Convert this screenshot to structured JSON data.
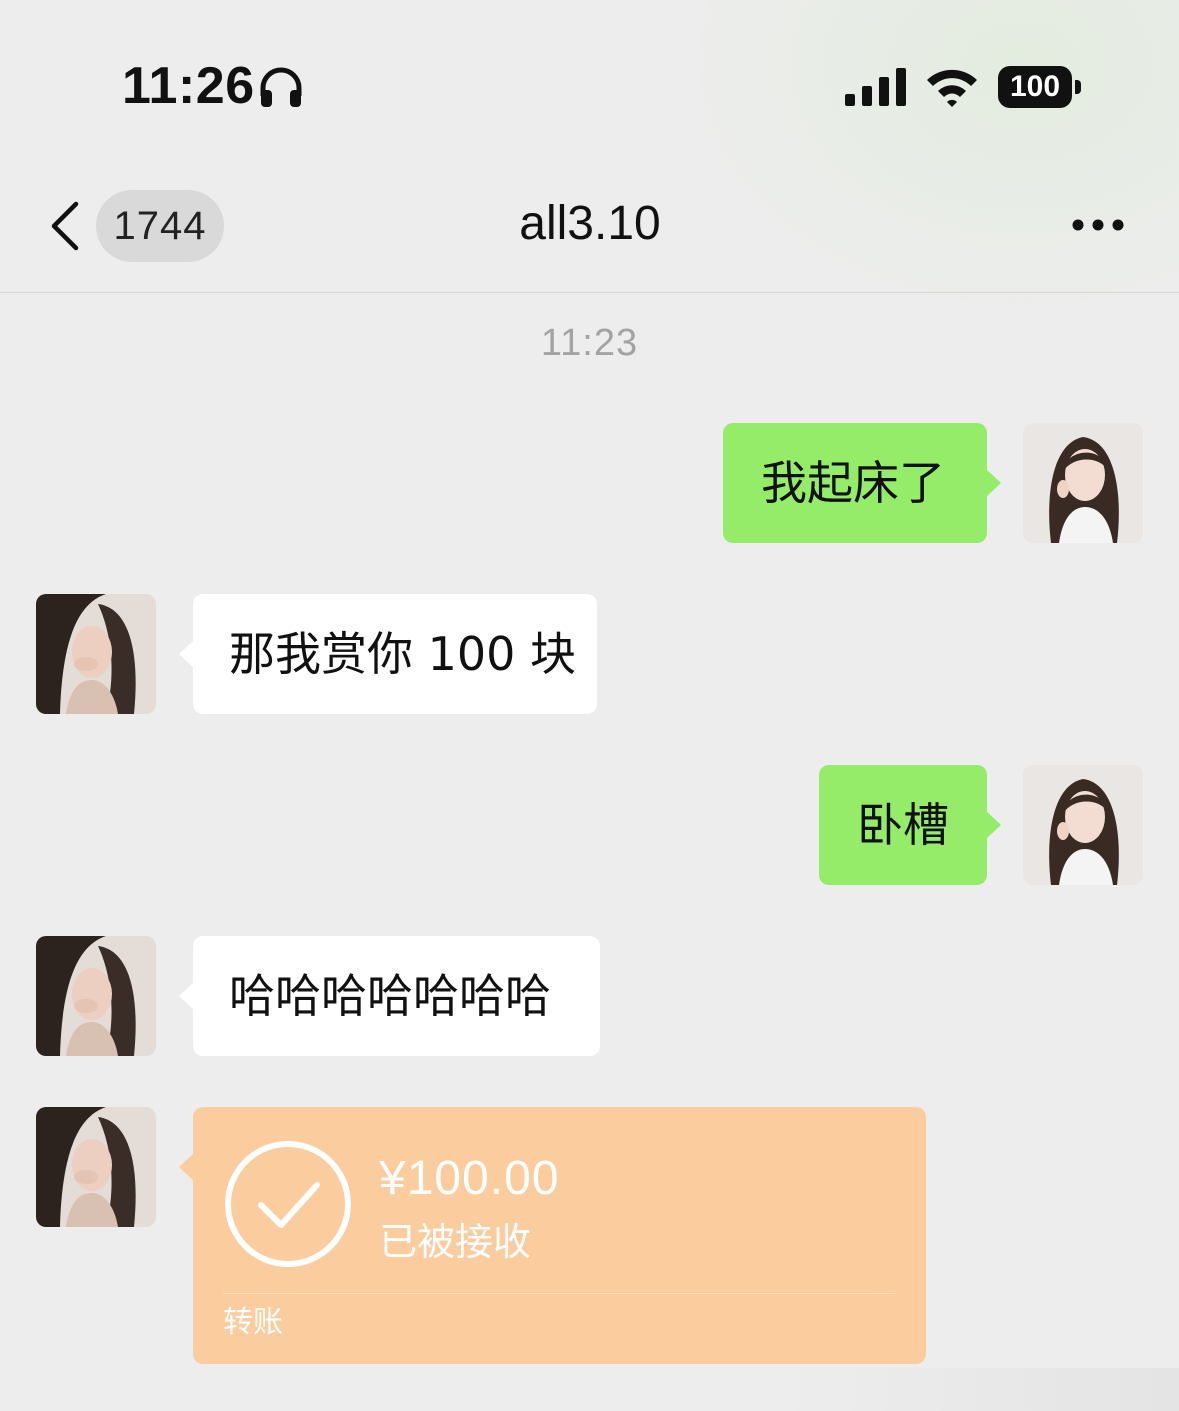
{
  "status_bar": {
    "time": "11:26",
    "battery": "100"
  },
  "nav": {
    "unread_count": "1744",
    "title": "all3.10"
  },
  "chat": {
    "timestamp": "11:23",
    "messages": [
      {
        "side": "sent",
        "text": "我起床了"
      },
      {
        "side": "received",
        "text": "那我赏你 100 块"
      },
      {
        "side": "sent",
        "text": "卧槽"
      },
      {
        "side": "received",
        "text": "哈哈哈哈哈哈哈"
      }
    ],
    "transfer": {
      "amount": "¥100.00",
      "status": "已被接收",
      "label": "转账"
    }
  },
  "colors": {
    "sent_bubble": "#95ec69",
    "received_bubble": "#ffffff",
    "transfer_card": "#fbcd9e",
    "background": "#ededed"
  },
  "icons": [
    "headphones-icon",
    "signal-icon",
    "wifi-icon",
    "battery-icon",
    "chevron-left-icon",
    "more-icon",
    "check-circle-icon"
  ]
}
